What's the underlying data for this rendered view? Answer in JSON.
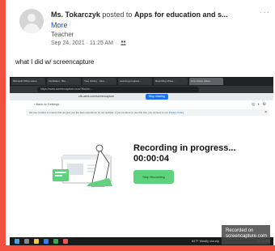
{
  "post": {
    "author": "Ms. Tokarczyk",
    "posted_to": "posted to",
    "group": "Apps for education and s...",
    "more": "More",
    "role": "Teacher",
    "date": "Sep 24, 2021 · 11:25 AM ·",
    "menu": "···",
    "text": "what I did w/ screencapture"
  },
  "screenshot": {
    "tabs": [
      "Microsoft Office Home",
      "Ira Nelson · Bre...",
      "Your Library · Scre...",
      "Learning progress...",
      "Recording Video...",
      "Live Online Video..."
    ],
    "url": "https://www.screencapture.com/?fbclid=...",
    "sharing_text": "cfb.uemr.com/screencapture",
    "stop_sharing": "Stop sharing",
    "back_link": "‹ Back to Settings",
    "banner_text": "We use cookies to ensure that we give you the best experience on our website. If you continue to use this site, you consent to our",
    "privacy_link": "Privacy Policy",
    "banner_close": "×",
    "recording_title": "Recording in progress...",
    "recording_time": "00:00:04",
    "stop_recording": "Stop Recording",
    "taskbar_status": "84°F  Mostly cloudy",
    "taskbar_time": "11:25 AM"
  },
  "watermark": {
    "line1": "Recorded on",
    "line2": "screencapture.com"
  },
  "colors": {
    "background": "#f0503d",
    "link": "#1a4fd6",
    "stop_button": "#5ed27c"
  }
}
